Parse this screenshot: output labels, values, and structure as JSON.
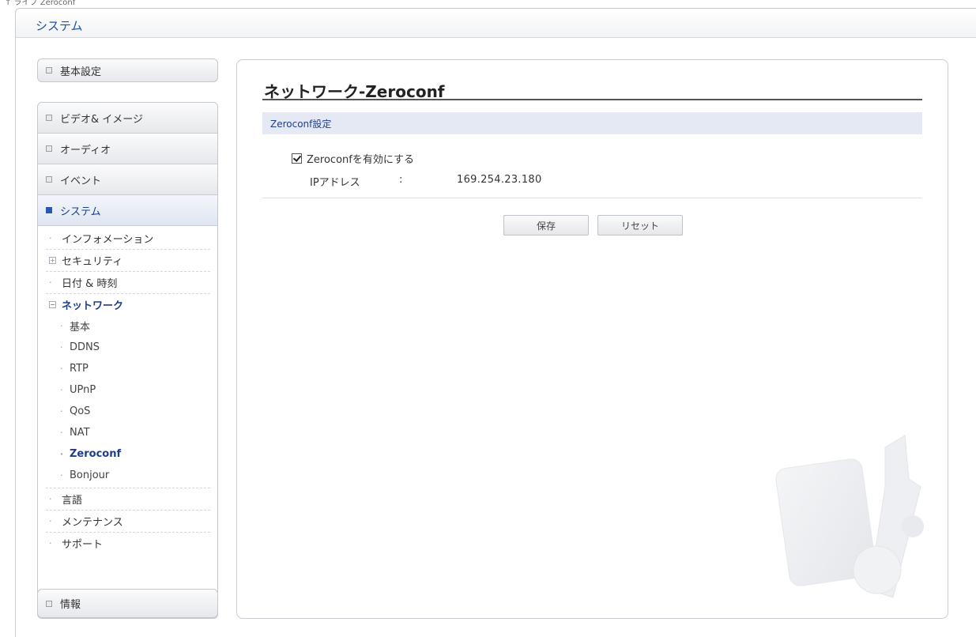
{
  "breadcrumb": "↑ ライブ  Zeroconf",
  "window_title": "システム",
  "sidebar": {
    "basic": "基本設定",
    "video": "ビデオ& イメージ",
    "audio": "オーディオ",
    "event": "イベント",
    "system": "システム",
    "info_item": "インフォメーション",
    "security": "セキュリティ",
    "datetime": "日付 & 時刻",
    "network": "ネットワーク",
    "network_children": [
      "基本",
      "DDNS",
      "RTP",
      "UPnP",
      "QoS",
      "NAT",
      "Zeroconf",
      "Bonjour"
    ],
    "language": "言語",
    "maintenance": "メンテナンス",
    "support": "サポート",
    "information": "情報"
  },
  "main": {
    "title": "ネットワーク-Zeroconf",
    "section": "Zeroconf設定",
    "enable_label": "Zeroconfを有効にする",
    "enable_checked": true,
    "ip_label": "IPアドレス",
    "ip_colon": ":",
    "ip_value": "169.254.23.180",
    "save_label": "保存",
    "reset_label": "リセット"
  },
  "colors": {
    "accent": "#1d3c8c",
    "section_bg": "#e5e9f3"
  }
}
